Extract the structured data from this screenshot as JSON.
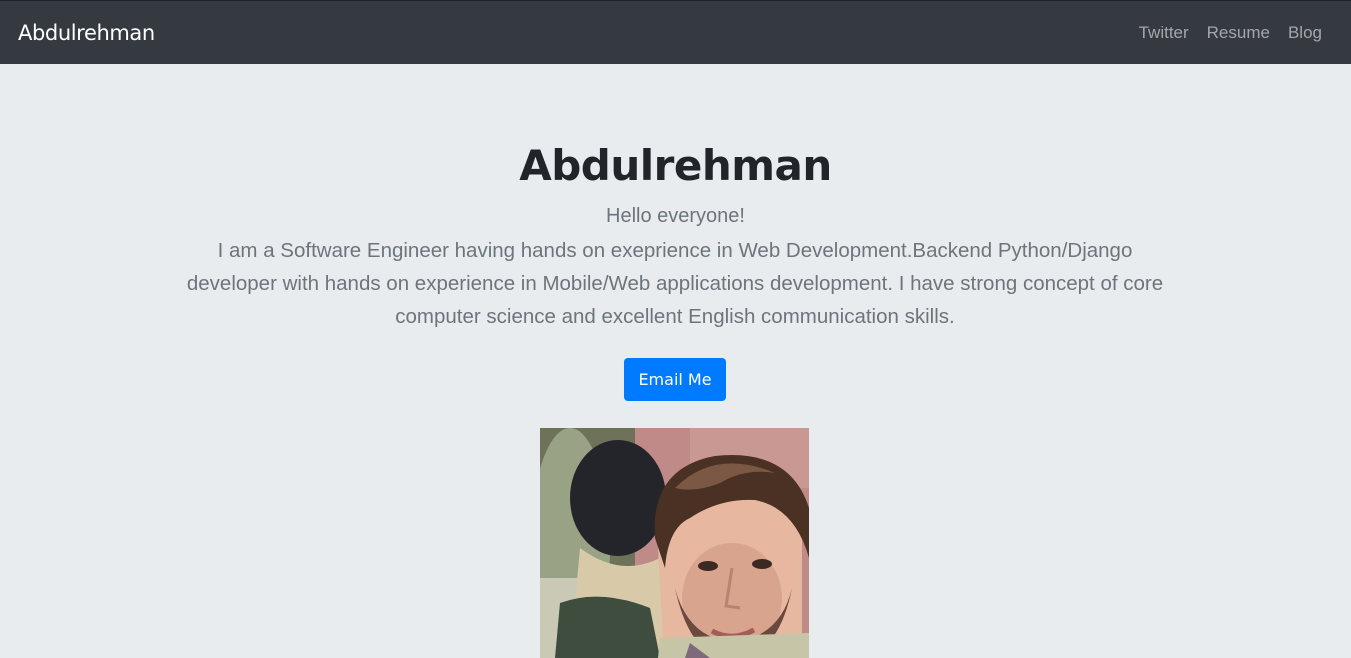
{
  "navbar": {
    "brand": "Abdulrehman",
    "links": [
      {
        "label": "Twitter"
      },
      {
        "label": "Resume"
      },
      {
        "label": "Blog"
      }
    ]
  },
  "hero": {
    "title": "Abdulrehman",
    "greeting": "Hello everyone!",
    "description": "I am a Software Engineer having hands on exeprience in Web Development.Backend Python/Django developer with hands on experience in Mobile/Web applications development. I have strong concept of core computer science and excellent English communication skills.",
    "button_label": "Email Me",
    "avatar_icon": "profile-photo"
  },
  "colors": {
    "navbar_bg": "#343a40",
    "page_bg": "#e9ecef",
    "primary": "#007bff"
  }
}
